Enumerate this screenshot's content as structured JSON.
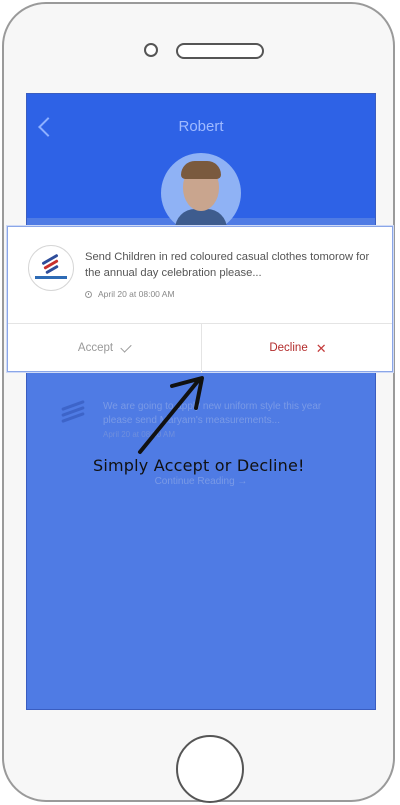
{
  "header": {
    "title": "Robert",
    "back_icon": "chevron-left-icon"
  },
  "background_card": {
    "text": "We are going to apply new uniform style this year please send Maryam's measurements...",
    "date": "April 20 at 08:00 AM",
    "continue_label": "Continue Reading →"
  },
  "popup": {
    "message": "Send Children in red coloured casual clothes tomorow for the annual day celebration please...",
    "date": "April 20 at 08:00 AM",
    "accept_label": "Accept",
    "decline_label": "Decline"
  },
  "annotation": {
    "text": "Simply Accept or Decline!"
  },
  "colors": {
    "screen": "#4f7be4",
    "header": "#2e62e6",
    "decline": "#b32c2c"
  }
}
